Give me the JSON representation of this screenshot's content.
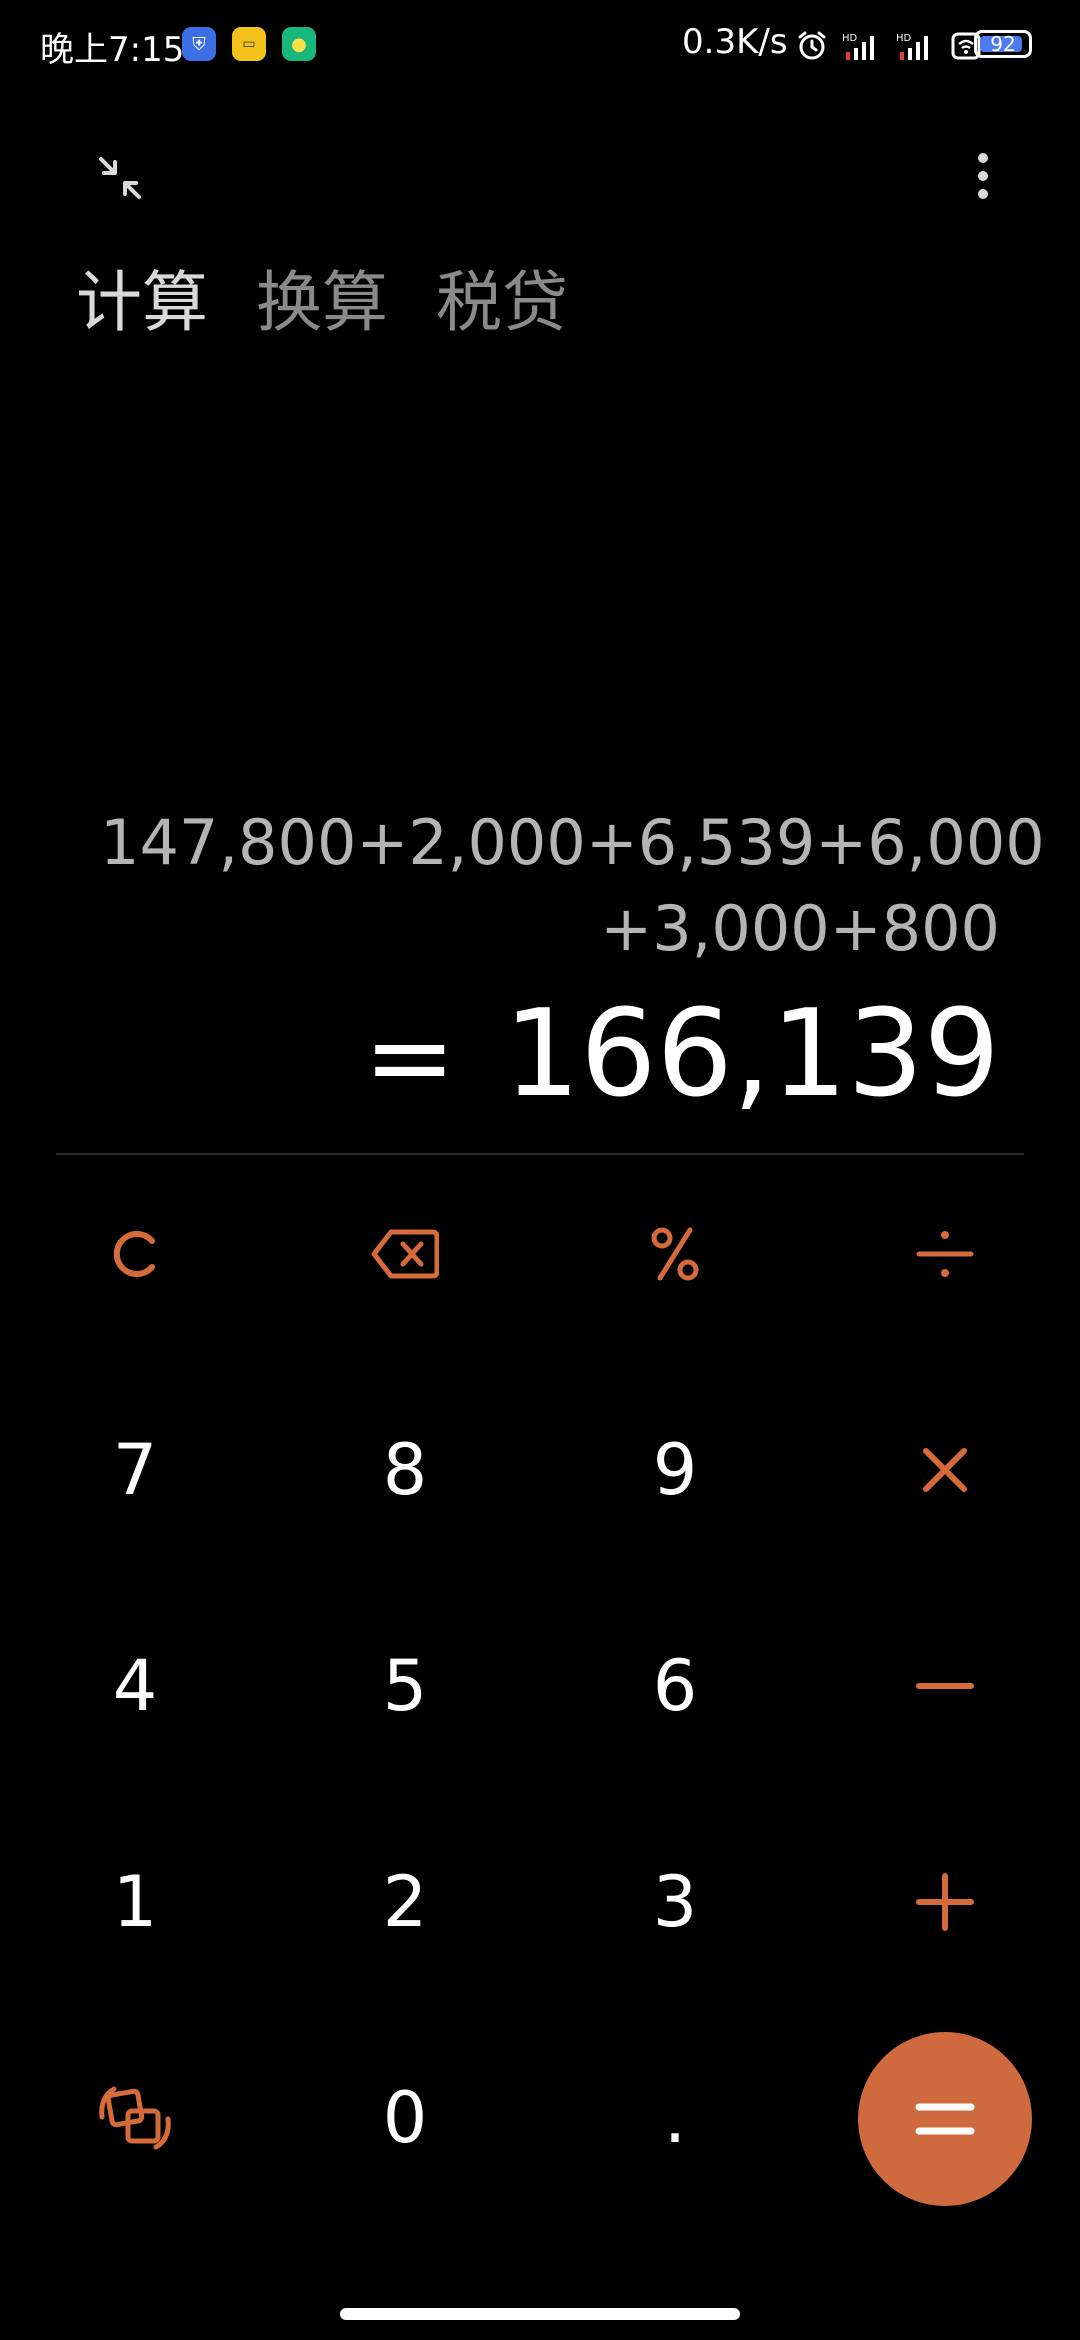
{
  "status_bar": {
    "time": "晚上7:15",
    "net_speed": "0.3K/s",
    "battery_level": "92",
    "battery_fraction": 0.92,
    "icons": [
      "shield-app-icon",
      "yellow-app-icon",
      "green-app-icon",
      "alarm-icon",
      "signal-hd-icon",
      "signal-hd-icon-2",
      "wifi-icon",
      "battery-icon"
    ]
  },
  "tabs": [
    {
      "label": "计算",
      "active": true
    },
    {
      "label": "换算",
      "active": false
    },
    {
      "label": "税贷",
      "active": false
    }
  ],
  "display": {
    "expression_line1": "147,800+2,000+6,539+6,000",
    "expression_line2": "+3,000+800",
    "result_sign": "=",
    "result_value": "166,139"
  },
  "keys": {
    "row1": [
      "C",
      "backspace",
      "%",
      "÷"
    ],
    "row2": [
      "7",
      "8",
      "9",
      "×"
    ],
    "row3": [
      "4",
      "5",
      "6",
      "−"
    ],
    "row4": [
      "1",
      "2",
      "3",
      "+"
    ],
    "row5": [
      "switch-mode",
      "0",
      ".",
      "="
    ]
  },
  "labels": {
    "digit_7": "7",
    "digit_8": "8",
    "digit_9": "9",
    "digit_4": "4",
    "digit_5": "5",
    "digit_6": "6",
    "digit_1": "1",
    "digit_2": "2",
    "digit_3": "3",
    "digit_0": "0",
    "decimal": "."
  },
  "colors": {
    "accent": "#d56a3b",
    "equals_button": "#cf6a3f",
    "background": "#000000",
    "expression_text": "#b4b4b4"
  }
}
